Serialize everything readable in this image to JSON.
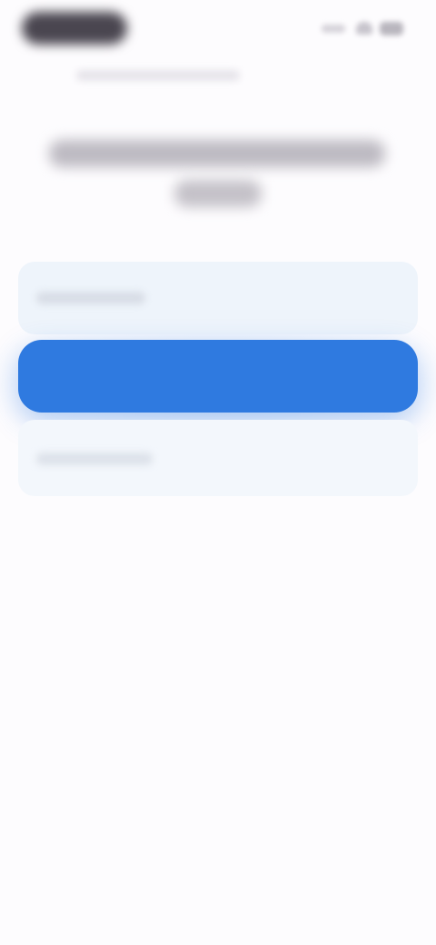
{
  "status_bar": {
    "time": ""
  },
  "header": {
    "subtitle": "",
    "title": ""
  },
  "options": [
    {
      "label": "",
      "selected": false
    },
    {
      "label": "",
      "selected": true
    },
    {
      "label": "",
      "selected": false
    }
  ],
  "colors": {
    "accent": "#2f7ae0",
    "option_background": "#eef4fb",
    "page_background": "#fdfcfe",
    "heading_text": "#4a474f",
    "status_pill": "#4a4650"
  },
  "icons": {
    "signal": "cellular-signal-icon",
    "wifi": "wifi-icon",
    "battery": "battery-icon"
  }
}
